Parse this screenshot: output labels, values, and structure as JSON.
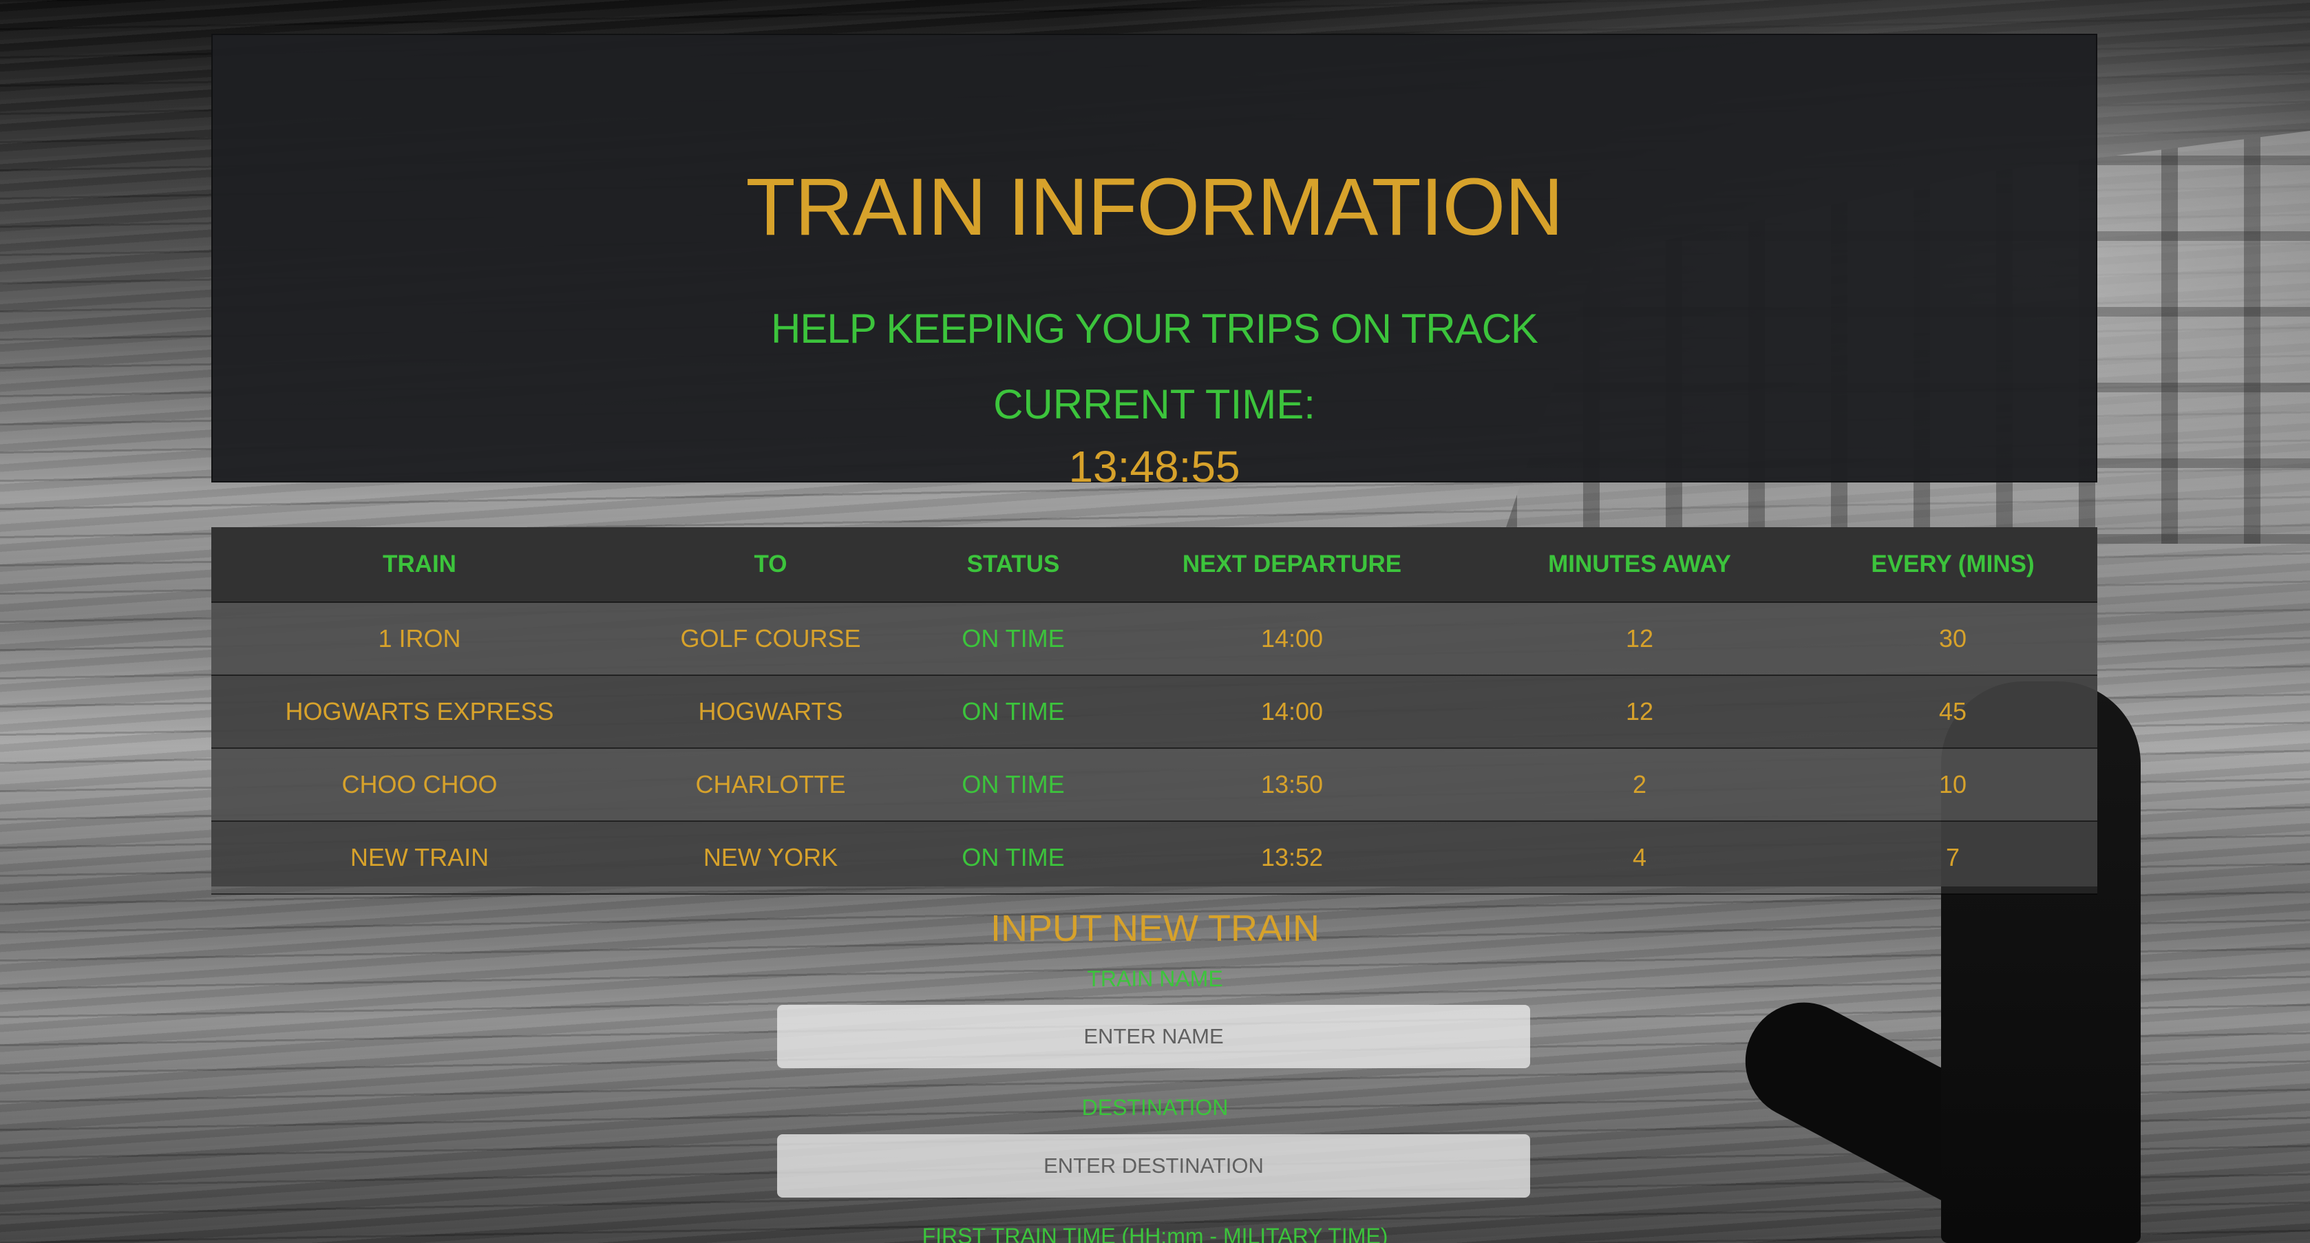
{
  "header": {
    "title": "TRAIN INFORMATION",
    "tagline": "HELP KEEPING YOUR TRIPS ON TRACK",
    "time_label": "CURRENT TIME:",
    "time_value": "13:48:55"
  },
  "table": {
    "columns": [
      "TRAIN",
      "TO",
      "STATUS",
      "NEXT DEPARTURE",
      "MINUTES AWAY",
      "EVERY (MINS)"
    ],
    "rows": [
      {
        "train": "1 IRON",
        "to": "GOLF COURSE",
        "status": "ON TIME",
        "next": "14:00",
        "away": "12",
        "every": "30"
      },
      {
        "train": "HOGWARTS EXPRESS",
        "to": "HOGWARTS",
        "status": "ON TIME",
        "next": "14:00",
        "away": "12",
        "every": "45"
      },
      {
        "train": "CHOO CHOO",
        "to": "CHARLOTTE",
        "status": "ON TIME",
        "next": "13:50",
        "away": "2",
        "every": "10"
      },
      {
        "train": "NEW TRAIN",
        "to": "NEW YORK",
        "status": "ON TIME",
        "next": "13:52",
        "away": "4",
        "every": "7"
      }
    ]
  },
  "form": {
    "title": "INPUT NEW TRAIN",
    "name_label": "TRAIN NAME",
    "name_placeholder": "ENTER NAME",
    "destination_label": "DESTINATION",
    "destination_placeholder": "ENTER DESTINATION",
    "first_time_label": "FIRST TRAIN TIME (HH:mm - MILITARY TIME)"
  },
  "colors": {
    "accent_gold": "#d7a22b",
    "accent_green": "#3cc43c",
    "panel_dark": "#1e1f22"
  }
}
